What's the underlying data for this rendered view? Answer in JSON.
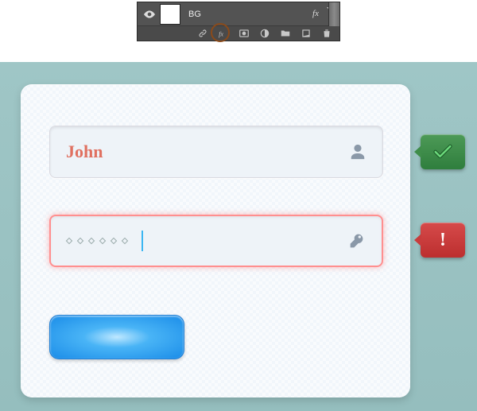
{
  "ps_panel": {
    "layer_name": "BG",
    "fx_label": "fx"
  },
  "form": {
    "username": {
      "value": "John"
    },
    "password": {
      "masked_chars": 6
    },
    "validation": {
      "success_icon": "check-icon",
      "error_text": "!"
    }
  }
}
